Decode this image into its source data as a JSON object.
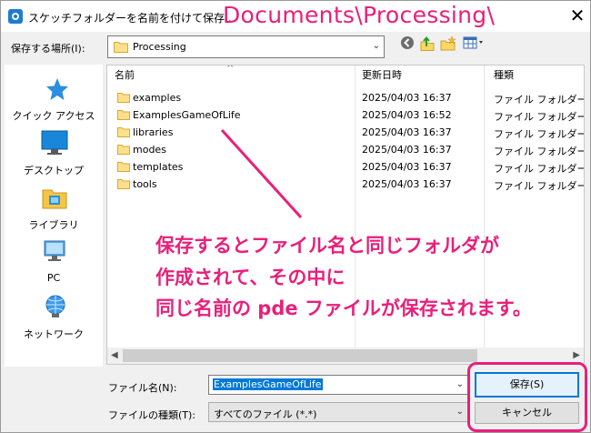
{
  "window": {
    "title": "スケッチフォルダーを名前を付けて保存...",
    "annotation_path": "Documents\\Processing\\",
    "close_symbol": "✕"
  },
  "location": {
    "label": "保存する場所(I):",
    "value": "Processing",
    "dropdown_symbol": "⌄"
  },
  "toolbar": {
    "back_icon": "back-icon",
    "up_icon": "up-folder-icon",
    "new_folder_icon": "new-folder-icon",
    "view_menu_icon": "view-menu-icon"
  },
  "places": [
    {
      "label": "クイック アクセス",
      "icon": "quick-access-star-icon"
    },
    {
      "label": "デスクトップ",
      "icon": "desktop-icon"
    },
    {
      "label": "ライブラリ",
      "icon": "library-icon"
    },
    {
      "label": "PC",
      "icon": "pc-icon"
    },
    {
      "label": "ネットワーク",
      "icon": "network-icon"
    }
  ],
  "filelist": {
    "columns": {
      "name": "名前",
      "date": "更新日時",
      "type": "種類"
    },
    "rows": [
      {
        "name": "examples",
        "date": "2025/04/03 16:37",
        "type": "ファイル フォルダー"
      },
      {
        "name": "ExamplesGameOfLife",
        "date": "2025/04/03 16:52",
        "type": "ファイル フォルダー"
      },
      {
        "name": "libraries",
        "date": "2025/04/03 16:37",
        "type": "ファイル フォルダー"
      },
      {
        "name": "modes",
        "date": "2025/04/03 16:37",
        "type": "ファイル フォルダー"
      },
      {
        "name": "templates",
        "date": "2025/04/03 16:37",
        "type": "ファイル フォルダー"
      },
      {
        "name": "tools",
        "date": "2025/04/03 16:37",
        "type": "ファイル フォルダー"
      }
    ]
  },
  "annotation": {
    "lines": [
      "保存するとファイル名と同じフォルダが",
      "作成されて、その中に",
      "同じ名前の pde ファイルが保存されます。"
    ],
    "color": "#e8207a"
  },
  "filename": {
    "label": "ファイル名(N):",
    "value": "ExamplesGameOfLife"
  },
  "filetype": {
    "label": "ファイルの種類(T):",
    "value": "すべてのファイル (*.*)"
  },
  "buttons": {
    "save": "保存(S)",
    "cancel": "キャンセル"
  }
}
